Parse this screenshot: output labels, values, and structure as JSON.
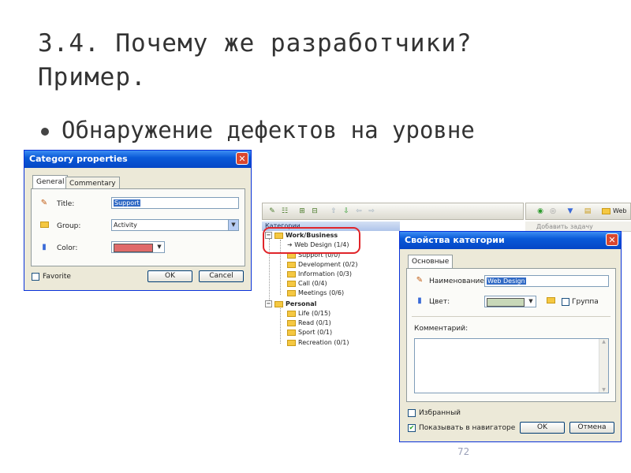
{
  "slide": {
    "title_line1": "3.4. Почему же разработчики?",
    "title_line2": "Пример.",
    "bullet": "Обнаружение дефектов на уровне",
    "page_number": "72"
  },
  "dialog_en": {
    "title": "Category properties",
    "close": "✕",
    "tabs": [
      "General",
      "Commentary"
    ],
    "title_label": "Title:",
    "title_value": "Support",
    "group_label": "Group:",
    "group_value": "Activity",
    "color_label": "Color:",
    "color_swatch": "#e06a6a",
    "favorite_label": "Favorite",
    "ok_label": "OK",
    "cancel_label": "Cancel"
  },
  "tree": {
    "header": "Категории",
    "groups": [
      {
        "name": "Work/Business",
        "items": [
          "Web Design (1/4)",
          "Support (0/0)",
          "Development (0/2)",
          "Information (0/3)",
          "Call (0/4)",
          "Meetings (0/6)"
        ]
      },
      {
        "name": "Personal",
        "items": [
          "Life (0/15)",
          "Read (0/1)",
          "Sport (0/1)",
          "Recreation (0/1)"
        ]
      }
    ]
  },
  "right_panel": {
    "toolbar_text": "Web",
    "row_text": "Добавить задачу"
  },
  "dialog_ru": {
    "title": "Свойства категории",
    "close": "✕",
    "tab": "Основные",
    "name_label": "Наименование:",
    "name_value": "Web Design",
    "color_label": "Цвет:",
    "color_swatch": "#c8d8b8",
    "group_checkbox_label": "Группа",
    "comment_label": "Комментарий:",
    "comment_value": "",
    "favorite_label": "Избранный",
    "favorite_checked": false,
    "show_in_nav_label": "Показывать в навигаторе",
    "show_in_nav_checked": true,
    "ok_label": "OK",
    "cancel_label": "Отмена"
  },
  "colors": {
    "xp_blue": "#0a5ad8",
    "dialog_bg": "#ece9d8",
    "highlight_red": "#e0252a"
  }
}
